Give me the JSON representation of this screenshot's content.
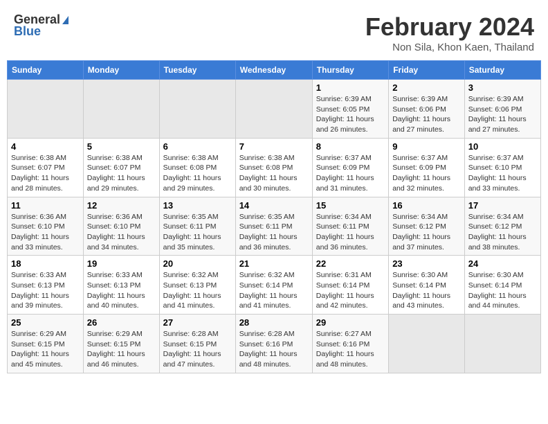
{
  "header": {
    "logo_general": "General",
    "logo_blue": "Blue",
    "month_title": "February 2024",
    "location": "Non Sila, Khon Kaen, Thailand"
  },
  "calendar": {
    "days_of_week": [
      "Sunday",
      "Monday",
      "Tuesday",
      "Wednesday",
      "Thursday",
      "Friday",
      "Saturday"
    ],
    "weeks": [
      [
        {
          "day": "",
          "info": ""
        },
        {
          "day": "",
          "info": ""
        },
        {
          "day": "",
          "info": ""
        },
        {
          "day": "",
          "info": ""
        },
        {
          "day": "1",
          "info": "Sunrise: 6:39 AM\nSunset: 6:05 PM\nDaylight: 11 hours and 26 minutes."
        },
        {
          "day": "2",
          "info": "Sunrise: 6:39 AM\nSunset: 6:06 PM\nDaylight: 11 hours and 27 minutes."
        },
        {
          "day": "3",
          "info": "Sunrise: 6:39 AM\nSunset: 6:06 PM\nDaylight: 11 hours and 27 minutes."
        }
      ],
      [
        {
          "day": "4",
          "info": "Sunrise: 6:38 AM\nSunset: 6:07 PM\nDaylight: 11 hours and 28 minutes."
        },
        {
          "day": "5",
          "info": "Sunrise: 6:38 AM\nSunset: 6:07 PM\nDaylight: 11 hours and 29 minutes."
        },
        {
          "day": "6",
          "info": "Sunrise: 6:38 AM\nSunset: 6:08 PM\nDaylight: 11 hours and 29 minutes."
        },
        {
          "day": "7",
          "info": "Sunrise: 6:38 AM\nSunset: 6:08 PM\nDaylight: 11 hours and 30 minutes."
        },
        {
          "day": "8",
          "info": "Sunrise: 6:37 AM\nSunset: 6:09 PM\nDaylight: 11 hours and 31 minutes."
        },
        {
          "day": "9",
          "info": "Sunrise: 6:37 AM\nSunset: 6:09 PM\nDaylight: 11 hours and 32 minutes."
        },
        {
          "day": "10",
          "info": "Sunrise: 6:37 AM\nSunset: 6:10 PM\nDaylight: 11 hours and 33 minutes."
        }
      ],
      [
        {
          "day": "11",
          "info": "Sunrise: 6:36 AM\nSunset: 6:10 PM\nDaylight: 11 hours and 33 minutes."
        },
        {
          "day": "12",
          "info": "Sunrise: 6:36 AM\nSunset: 6:10 PM\nDaylight: 11 hours and 34 minutes."
        },
        {
          "day": "13",
          "info": "Sunrise: 6:35 AM\nSunset: 6:11 PM\nDaylight: 11 hours and 35 minutes."
        },
        {
          "day": "14",
          "info": "Sunrise: 6:35 AM\nSunset: 6:11 PM\nDaylight: 11 hours and 36 minutes."
        },
        {
          "day": "15",
          "info": "Sunrise: 6:34 AM\nSunset: 6:11 PM\nDaylight: 11 hours and 36 minutes."
        },
        {
          "day": "16",
          "info": "Sunrise: 6:34 AM\nSunset: 6:12 PM\nDaylight: 11 hours and 37 minutes."
        },
        {
          "day": "17",
          "info": "Sunrise: 6:34 AM\nSunset: 6:12 PM\nDaylight: 11 hours and 38 minutes."
        }
      ],
      [
        {
          "day": "18",
          "info": "Sunrise: 6:33 AM\nSunset: 6:13 PM\nDaylight: 11 hours and 39 minutes."
        },
        {
          "day": "19",
          "info": "Sunrise: 6:33 AM\nSunset: 6:13 PM\nDaylight: 11 hours and 40 minutes."
        },
        {
          "day": "20",
          "info": "Sunrise: 6:32 AM\nSunset: 6:13 PM\nDaylight: 11 hours and 41 minutes."
        },
        {
          "day": "21",
          "info": "Sunrise: 6:32 AM\nSunset: 6:14 PM\nDaylight: 11 hours and 41 minutes."
        },
        {
          "day": "22",
          "info": "Sunrise: 6:31 AM\nSunset: 6:14 PM\nDaylight: 11 hours and 42 minutes."
        },
        {
          "day": "23",
          "info": "Sunrise: 6:30 AM\nSunset: 6:14 PM\nDaylight: 11 hours and 43 minutes."
        },
        {
          "day": "24",
          "info": "Sunrise: 6:30 AM\nSunset: 6:14 PM\nDaylight: 11 hours and 44 minutes."
        }
      ],
      [
        {
          "day": "25",
          "info": "Sunrise: 6:29 AM\nSunset: 6:15 PM\nDaylight: 11 hours and 45 minutes."
        },
        {
          "day": "26",
          "info": "Sunrise: 6:29 AM\nSunset: 6:15 PM\nDaylight: 11 hours and 46 minutes."
        },
        {
          "day": "27",
          "info": "Sunrise: 6:28 AM\nSunset: 6:15 PM\nDaylight: 11 hours and 47 minutes."
        },
        {
          "day": "28",
          "info": "Sunrise: 6:28 AM\nSunset: 6:16 PM\nDaylight: 11 hours and 48 minutes."
        },
        {
          "day": "29",
          "info": "Sunrise: 6:27 AM\nSunset: 6:16 PM\nDaylight: 11 hours and 48 minutes."
        },
        {
          "day": "",
          "info": ""
        },
        {
          "day": "",
          "info": ""
        }
      ]
    ]
  }
}
